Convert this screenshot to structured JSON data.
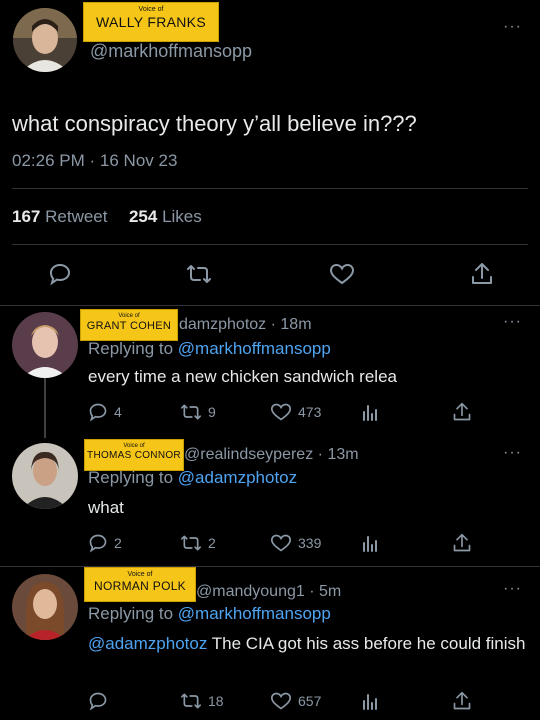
{
  "main_tweet": {
    "nameplate": {
      "small": "Voice of",
      "big": "WALLY FRANKS"
    },
    "handle": "@markhoffmansopp",
    "text": "what conspiracy theory y’all believe in???",
    "time": "02:26 PM",
    "date": "16 Nov 23",
    "retweets_count": "167",
    "retweets_label": "Retweet",
    "likes_count": "254",
    "likes_label": "Likes"
  },
  "replies": [
    {
      "nameplate": {
        "small": "Voice of",
        "big": "GRANT COHEN"
      },
      "handle": "damzphotoz",
      "age": "18m",
      "replying_label": "Replying to",
      "replying_to": "@markhoffmansopp",
      "text": "every time a new chicken sandwich relea",
      "replies": "4",
      "retweets": "9",
      "likes": "473"
    },
    {
      "nameplate": {
        "small": "Voice of",
        "big": "THOMAS CONNOR"
      },
      "handle": "@realindseyperez",
      "age": "13m",
      "replying_label": "Replying to",
      "replying_to": "@adamzphotoz",
      "text": "what",
      "replies": "2",
      "retweets": "2",
      "likes": "339"
    },
    {
      "nameplate": {
        "small": "Voice of",
        "big": "NORMAN POLK"
      },
      "handle": "@mandyoung1",
      "age": "5m",
      "replying_label": "Replying to",
      "replying_to": "@markhoffmansopp",
      "mention": "@adamzphotoz",
      "text": "The CIA got his ass before he could finish",
      "replies": "",
      "retweets": "18",
      "likes": "657"
    }
  ],
  "separator": "·",
  "more_icon": "···",
  "icons": [
    "reply-icon",
    "retweet-icon",
    "like-icon",
    "share-icon",
    "views-icon",
    "more-icon"
  ],
  "colors": {
    "background": "#000000",
    "text": "#e7e9ea",
    "muted": "#8b98a5",
    "link": "#4ea4f1",
    "nameplate": "#f5c518",
    "divider": "#2f3336"
  }
}
